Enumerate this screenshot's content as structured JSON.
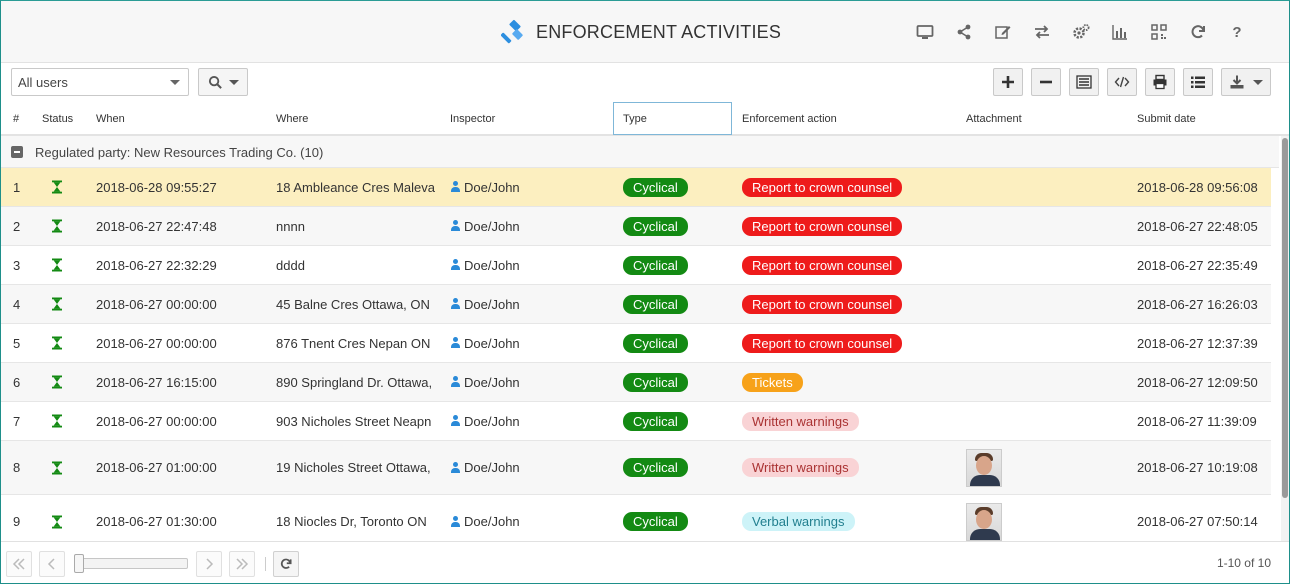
{
  "header": {
    "title": "ENFORCEMENT ACTIVITIES",
    "icons": [
      "monitor-icon",
      "share-icon",
      "edit-icon",
      "swap-icon",
      "settings-icon",
      "chart-icon",
      "qr-icon",
      "refresh-icon",
      "help-icon"
    ],
    "help_glyph": "?"
  },
  "toolbar": {
    "user_filter": "All users",
    "buttons": [
      "add-icon",
      "remove-icon",
      "columns-icon",
      "code-icon",
      "print-icon",
      "list-icon",
      "download-icon"
    ]
  },
  "columns": [
    "#",
    "Status",
    "When",
    "Where",
    "Inspector",
    "Type",
    "Enforcement action",
    "Attachment",
    "Submit date"
  ],
  "group": {
    "label": "Regulated party: New Resources Trading Co. (10)"
  },
  "colors": {
    "accent": "#1e8f8a",
    "selected": "#fcefc0",
    "green": "#138a13",
    "red": "#ee1b1b",
    "orange": "#f7a21a"
  },
  "rows": [
    {
      "num": "1",
      "when": "2018-06-28 09:55:27",
      "where": "18 Ambleance Cres Maleva",
      "inspector": "Doe/John",
      "type": "Cyclical",
      "action": "Report to crown counsel",
      "action_style": "red",
      "attachment": false,
      "submit": "2018-06-28 09:56:08"
    },
    {
      "num": "2",
      "when": "2018-06-27 22:47:48",
      "where": "nnnn",
      "inspector": "Doe/John",
      "type": "Cyclical",
      "action": "Report to crown counsel",
      "action_style": "red",
      "attachment": false,
      "submit": "2018-06-27 22:48:05"
    },
    {
      "num": "3",
      "when": "2018-06-27 22:32:29",
      "where": "dddd",
      "inspector": "Doe/John",
      "type": "Cyclical",
      "action": "Report to crown counsel",
      "action_style": "red",
      "attachment": false,
      "submit": "2018-06-27 22:35:49"
    },
    {
      "num": "4",
      "when": "2018-06-27 00:00:00",
      "where": "45 Balne Cres Ottawa, ON",
      "inspector": "Doe/John",
      "type": "Cyclical",
      "action": "Report to crown counsel",
      "action_style": "red",
      "attachment": false,
      "submit": "2018-06-27 16:26:03"
    },
    {
      "num": "5",
      "when": "2018-06-27 00:00:00",
      "where": "876 Tnent Cres Nepan ON",
      "inspector": "Doe/John",
      "type": "Cyclical",
      "action": "Report to crown counsel",
      "action_style": "red",
      "attachment": false,
      "submit": "2018-06-27 12:37:39"
    },
    {
      "num": "6",
      "when": "2018-06-27 16:15:00",
      "where": "890 Springland Dr. Ottawa,",
      "inspector": "Doe/John",
      "type": "Cyclical",
      "action": "Tickets",
      "action_style": "orange",
      "attachment": false,
      "submit": "2018-06-27 12:09:50"
    },
    {
      "num": "7",
      "when": "2018-06-27 00:00:00",
      "where": "903 Nicholes Street Neapn",
      "inspector": "Doe/John",
      "type": "Cyclical",
      "action": "Written warnings",
      "action_style": "pink",
      "attachment": false,
      "submit": "2018-06-27 11:39:09"
    },
    {
      "num": "8",
      "when": "2018-06-27 01:00:00",
      "where": "19 Nicholes Street Ottawa,",
      "inspector": "Doe/John",
      "type": "Cyclical",
      "action": "Written warnings",
      "action_style": "pink",
      "attachment": true,
      "submit": "2018-06-27 10:19:08"
    },
    {
      "num": "9",
      "when": "2018-06-27 01:30:00",
      "where": "18 Niocles Dr, Toronto ON",
      "inspector": "Doe/John",
      "type": "Cyclical",
      "action": "Verbal warnings",
      "action_style": "cyan",
      "attachment": true,
      "submit": "2018-06-27 07:50:14"
    }
  ],
  "footer": {
    "count": "1-10 of 10"
  }
}
